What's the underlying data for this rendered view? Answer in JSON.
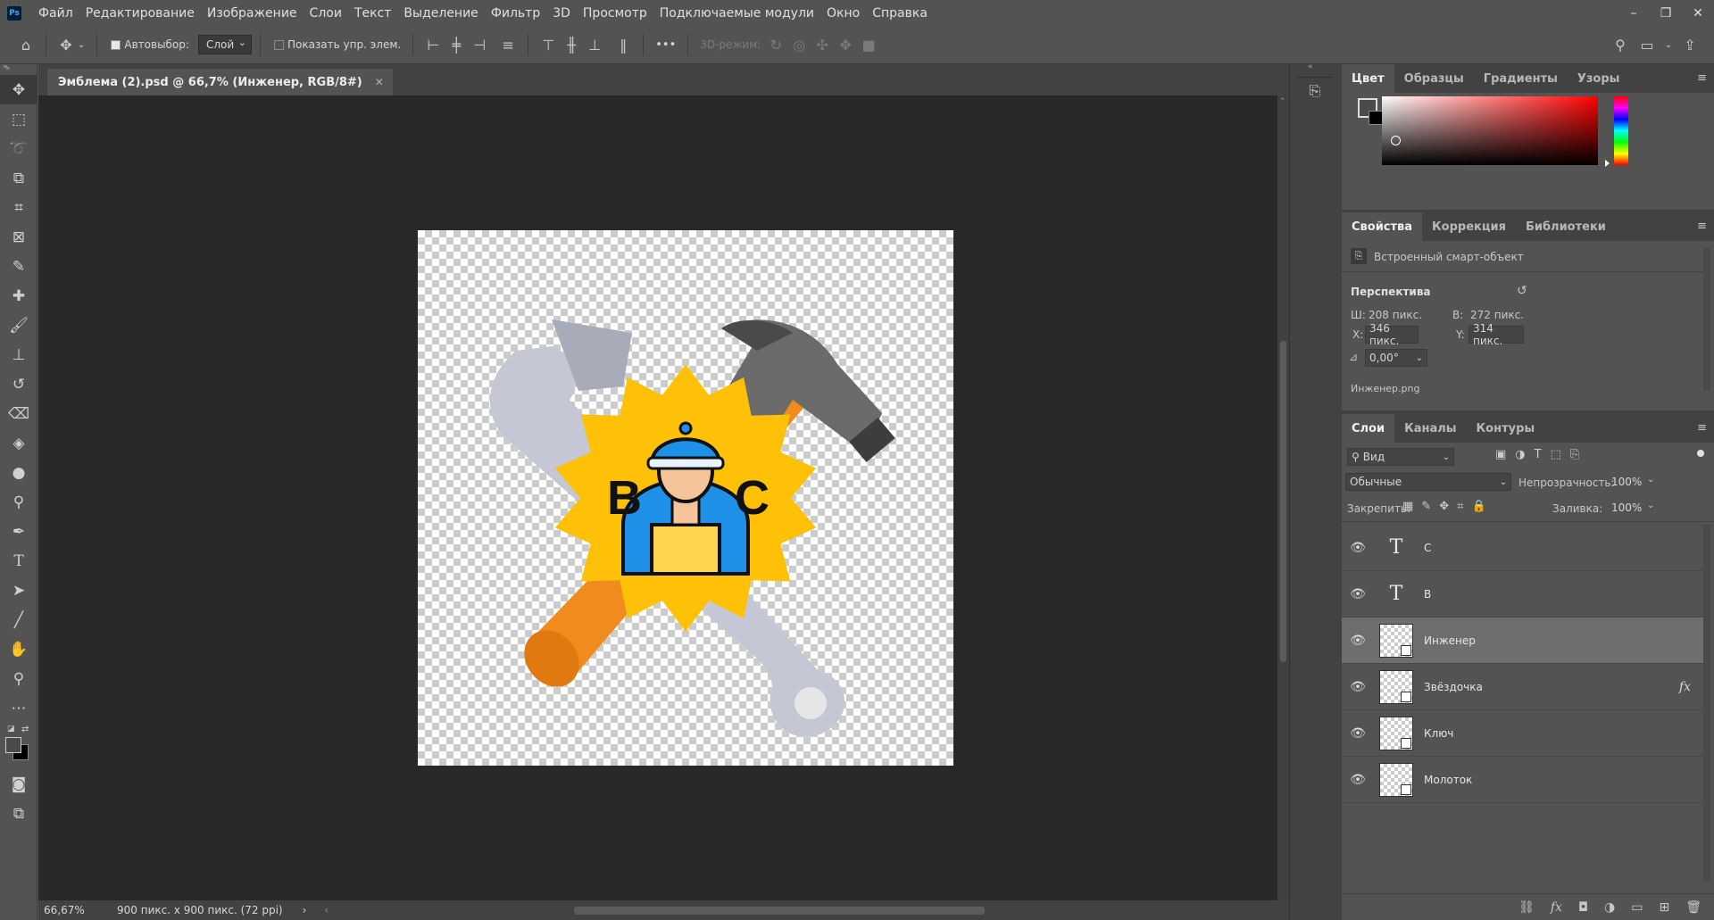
{
  "app": {
    "logo": "Ps",
    "menu": [
      "Файл",
      "Редактирование",
      "Изображение",
      "Слои",
      "Текст",
      "Выделение",
      "Фильтр",
      "3D",
      "Просмотр",
      "Подключаемые модули",
      "Окно",
      "Справка"
    ],
    "window_controls": [
      "–",
      "❐",
      "✕"
    ]
  },
  "options_bar": {
    "autoselect_label": "Автовыбор:",
    "autoselect_checked": true,
    "autoselect_target": "Слой",
    "show_transform_label": "Показать упр. элем.",
    "show_transform_checked": false,
    "more_label": "•••",
    "mode3d_label": "3D-режим:"
  },
  "document": {
    "tab_title": "Эмблема (2).psd @ 66,7% (Инженер, RGB/8#)",
    "zoom": "66,67%",
    "doc_info": "900 пикс. x 900 пикс. (72 ppi)"
  },
  "canvas_art": {
    "letter_left": "B",
    "letter_right": "C",
    "colors": {
      "star": "#ffc107",
      "hammer_handle": "#f08c1e",
      "hammer_head": "#6b6b6b",
      "wrench": "#c5c8d4",
      "helmet": "#1e90e8",
      "face": "#f6c49a"
    }
  },
  "color_panel": {
    "tabs": [
      "Цвет",
      "Образцы",
      "Градиенты",
      "Узоры"
    ],
    "active_tab": "Цвет",
    "hue": "#ff0000"
  },
  "properties_panel": {
    "tabs": [
      "Свойства",
      "Коррекция",
      "Библиотеки"
    ],
    "active_tab": "Свойства",
    "object_type": "Встроенный смарт-объект",
    "section": "Перспектива",
    "w_label": "Ш:",
    "w_value": "208 пикс.",
    "h_label": "В:",
    "h_value": "272 пикс.",
    "x_label": "X:",
    "x_value": "346 пикс.",
    "y_label": "Y:",
    "y_value": "314 пикс.",
    "angle_value": "0,00°",
    "file_name": "Инженер.png"
  },
  "layers_panel": {
    "tabs": [
      "Слои",
      "Каналы",
      "Контуры"
    ],
    "active_tab": "Слои",
    "filter_label": "Вид",
    "blend_mode": "Обычные",
    "opacity_label": "Непрозрачность:",
    "opacity_value": "100%",
    "lock_label": "Закрепить:",
    "fill_label": "Заливка:",
    "fill_value": "100%",
    "layers": [
      {
        "name": "C",
        "kind": "text",
        "thumb": "T",
        "selected": false,
        "fx": ""
      },
      {
        "name": "B",
        "kind": "text",
        "thumb": "T",
        "selected": false,
        "fx": ""
      },
      {
        "name": "Инженер",
        "kind": "smart",
        "thumb": "",
        "selected": true,
        "fx": ""
      },
      {
        "name": "Звёздочка",
        "kind": "smart",
        "thumb": "",
        "selected": false,
        "fx": "fx"
      },
      {
        "name": "Ключ",
        "kind": "smart",
        "thumb": "",
        "selected": false,
        "fx": ""
      },
      {
        "name": "Молоток",
        "kind": "smart",
        "thumb": "",
        "selected": false,
        "fx": ""
      }
    ]
  }
}
